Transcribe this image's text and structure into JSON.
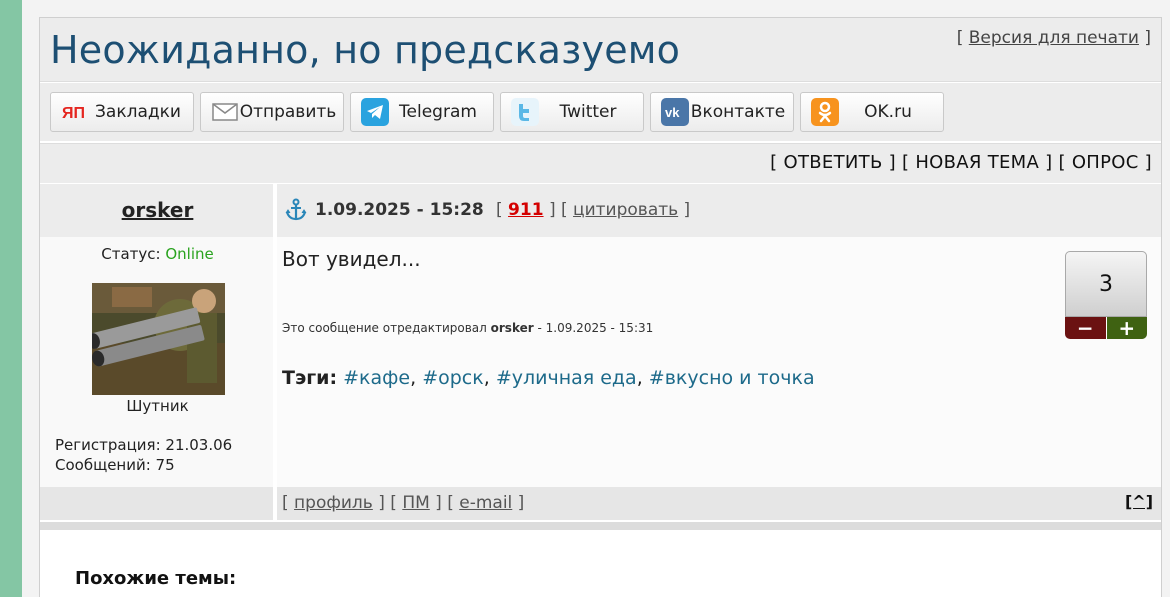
{
  "topic": {
    "title": "Неожиданно, но предсказуемо",
    "print_label": "Версия для печати"
  },
  "share": {
    "buttons": [
      {
        "label": "Закладки",
        "icon": "yandex-bookmarks-icon",
        "color": "#e52620"
      },
      {
        "label": "Отправить",
        "icon": "envelope-icon",
        "color": "#888888"
      },
      {
        "label": "Telegram",
        "icon": "telegram-icon",
        "color": "#2aa3df"
      },
      {
        "label": "Twitter",
        "icon": "twitter-icon",
        "color": "#1da1f2"
      },
      {
        "label": "Вконтакте",
        "icon": "vk-icon",
        "color": "#4a76a8"
      },
      {
        "label": "OK.ru",
        "icon": "odnoklassniki-icon",
        "color": "#f7931e"
      }
    ]
  },
  "actions": {
    "reply": "ОТВЕТИТЬ",
    "new_topic": "НОВАЯ ТЕМА",
    "poll": "ОПРОС"
  },
  "post": {
    "author": "orsker",
    "date": "1.09.2025 - 15:28",
    "number": "911",
    "quote_label": "цитировать",
    "status_label": "Статус:",
    "status_value": "Online",
    "status_color": "#2aa31f",
    "rank": "Шутник",
    "registration": "Регистрация: 21.03.06",
    "messages": "Сообщений: 75",
    "text": "Вот увидел...",
    "edited_prefix": "Это сообщение отредактировал",
    "edited_by": "orsker",
    "edited_suffix": "- 1.09.2025 - 15:31",
    "tags_label": "Тэги:",
    "tags": [
      "#кафе",
      "#орск",
      "#уличная еда",
      "#вкусно и точка"
    ],
    "rating": "3",
    "minus": "−",
    "plus": "+"
  },
  "footer": {
    "profile": "профиль",
    "pm": "ПМ",
    "email": "e-mail",
    "top": "[^]"
  },
  "similar": {
    "title": "Похожие темы:"
  }
}
